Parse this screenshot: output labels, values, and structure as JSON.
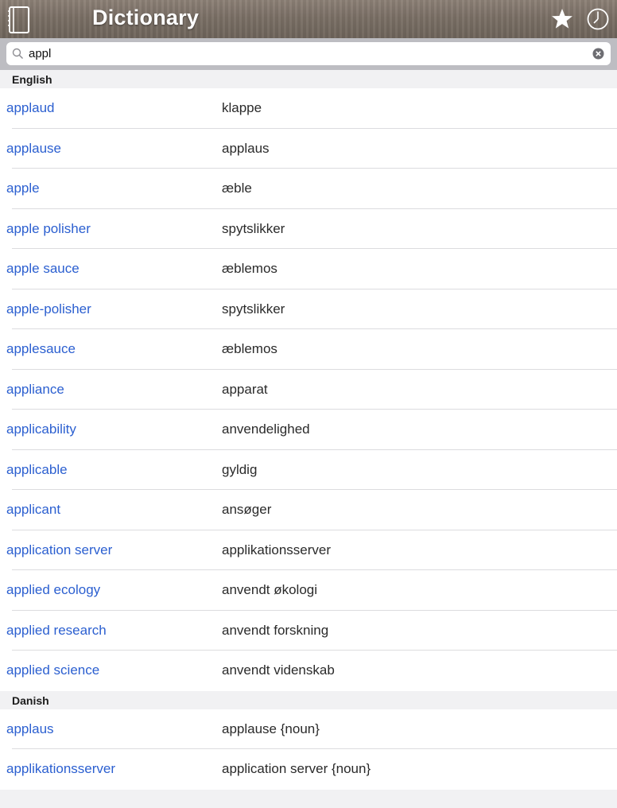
{
  "header": {
    "title": "Dictionary",
    "icons": {
      "left": "book-icon",
      "favorites": "star-icon",
      "history": "clock-icon"
    }
  },
  "search": {
    "value": "appl",
    "icon": "search-icon",
    "clear_icon": "clear-icon"
  },
  "sections": [
    {
      "title": "English",
      "rows": [
        {
          "term": "applaud",
          "translation": "klappe"
        },
        {
          "term": "applause",
          "translation": "applaus"
        },
        {
          "term": "apple",
          "translation": "æble"
        },
        {
          "term": "apple polisher",
          "translation": "spytslikker"
        },
        {
          "term": "apple sauce",
          "translation": "æblemos"
        },
        {
          "term": "apple-polisher",
          "translation": "spytslikker"
        },
        {
          "term": "applesauce",
          "translation": "æblemos"
        },
        {
          "term": "appliance",
          "translation": "apparat"
        },
        {
          "term": "applicability",
          "translation": "anvendelighed"
        },
        {
          "term": "applicable",
          "translation": "gyldig"
        },
        {
          "term": "applicant",
          "translation": "ansøger"
        },
        {
          "term": "application server",
          "translation": "applikationsserver"
        },
        {
          "term": "applied ecology",
          "translation": "anvendt økologi"
        },
        {
          "term": "applied research",
          "translation": "anvendt forskning"
        },
        {
          "term": "applied science",
          "translation": "anvendt videnskab"
        }
      ]
    },
    {
      "title": "Danish",
      "rows": [
        {
          "term": "applaus",
          "translation": "applause {noun}"
        },
        {
          "term": "applikationsserver",
          "translation": "application server {noun}"
        }
      ]
    }
  ],
  "colors": {
    "term_link": "#2b5fd0",
    "header_bar": "#7b7066",
    "section_bg": "#f1f1f3"
  }
}
